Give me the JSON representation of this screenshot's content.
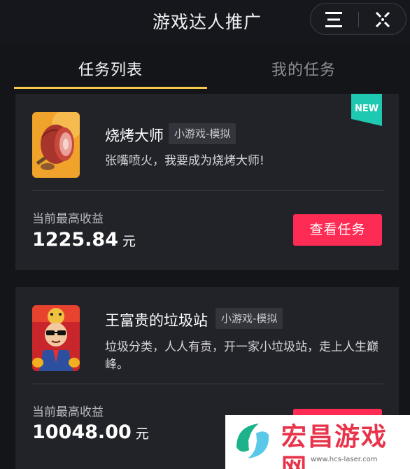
{
  "header": {
    "title": "游戏达人推广",
    "menu_icon": "menu-icon",
    "close_icon": "close-target-icon"
  },
  "tabs": [
    {
      "label": "任务列表",
      "active": true
    },
    {
      "label": "我的任务",
      "active": false
    }
  ],
  "tasks": [
    {
      "badge": "NEW",
      "icon": "roast-meat-game-icon",
      "name": "烧烤大师",
      "tag": "小游戏-模拟",
      "description": "张嘴喷火，我要成为烧烤大师!",
      "earnings_label": "当前最高收益",
      "earnings_amount": "1225.84",
      "earnings_unit": "元",
      "button_label": "查看任务"
    },
    {
      "icon": "junk-station-game-icon",
      "name": "王富贵的垃圾站",
      "tag": "小游戏-模拟",
      "description": "垃圾分类，人人有责，开一家小垃圾站，走上人生巅峰。",
      "earnings_label": "当前最高收益",
      "earnings_amount": "10048.00",
      "earnings_unit": "元"
    }
  ],
  "watermark": {
    "text": "宏昌游戏网",
    "url": "www.hcs-laser.com"
  },
  "colors": {
    "accent": "#fe2c55",
    "tab_underline": "#f5c94c",
    "new_badge": "#1fc9b1",
    "card_bg": "#222329"
  }
}
